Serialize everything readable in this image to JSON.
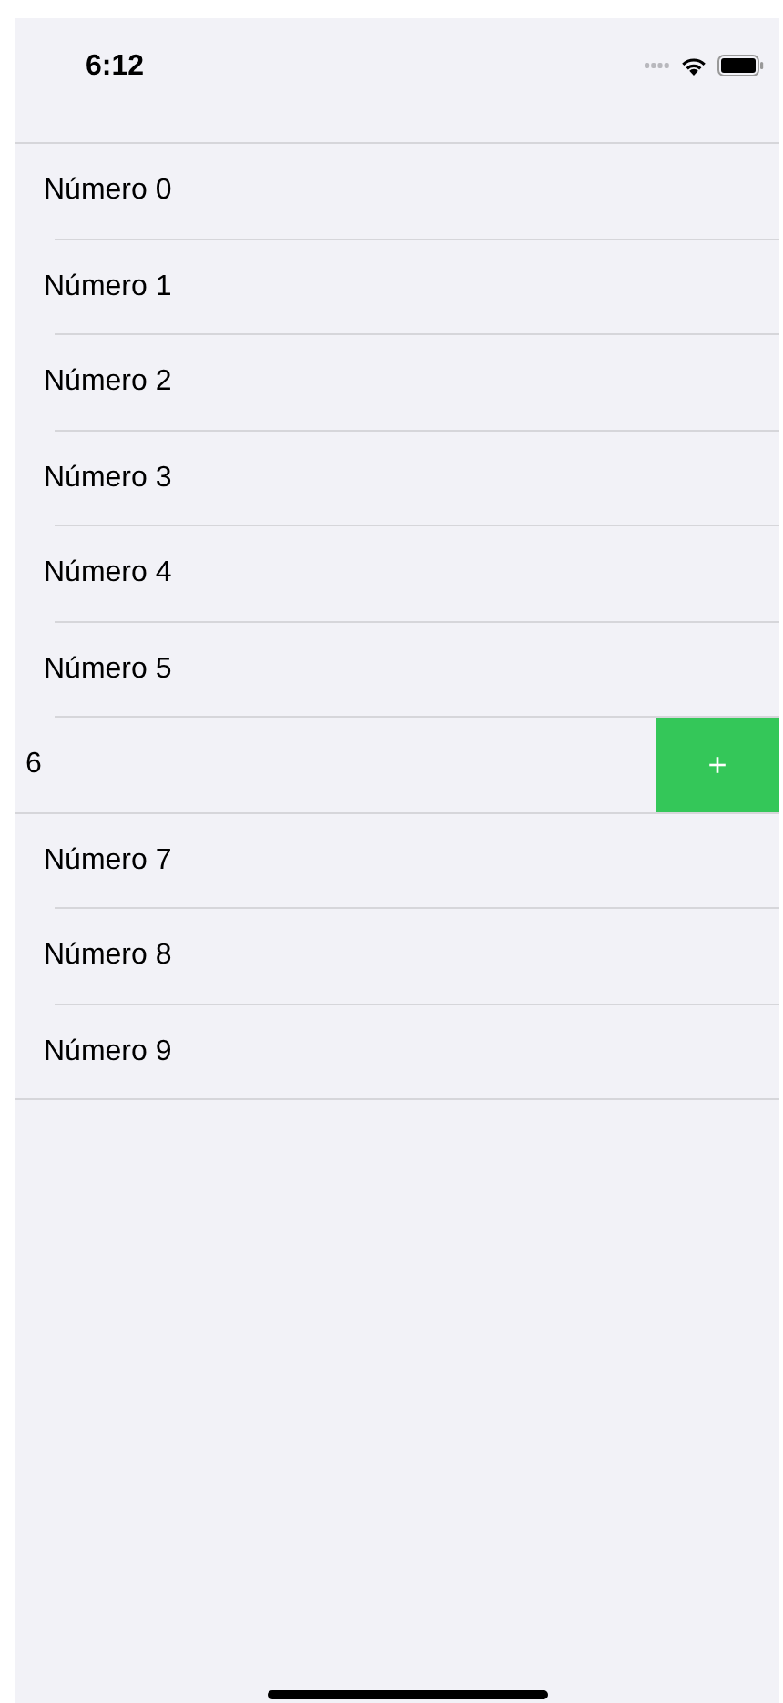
{
  "status_bar": {
    "time": "6:12"
  },
  "rows": [
    {
      "label": "Número 0",
      "swiped": false
    },
    {
      "label": "Número 1",
      "swiped": false
    },
    {
      "label": "Número 2",
      "swiped": false
    },
    {
      "label": "Número 3",
      "swiped": false
    },
    {
      "label": "Número 4",
      "swiped": false
    },
    {
      "label": "Número 5",
      "swiped": false
    },
    {
      "label": "6",
      "swiped": true,
      "action": "+"
    },
    {
      "label": "Número 7",
      "swiped": false
    },
    {
      "label": "Número 8",
      "swiped": false
    },
    {
      "label": "Número 9",
      "swiped": false
    }
  ]
}
